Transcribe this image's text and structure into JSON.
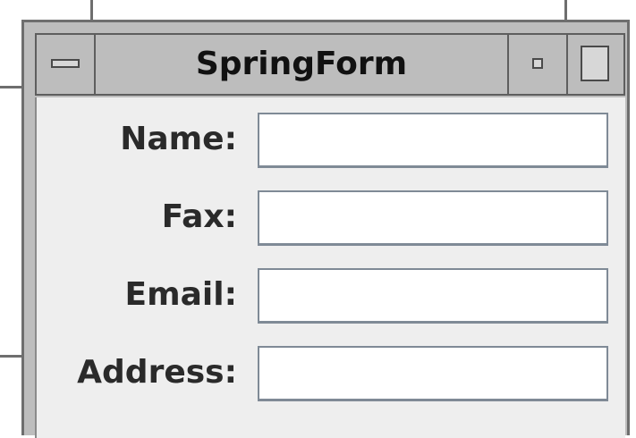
{
  "window": {
    "title": "SpringForm"
  },
  "titlebar": {
    "menu_icon": "window-menu-icon",
    "minimize_icon": "minimize-icon",
    "maximize_icon": "maximize-icon"
  },
  "form": {
    "fields": [
      {
        "label": "Name:",
        "value": ""
      },
      {
        "label": "Fax:",
        "value": ""
      },
      {
        "label": "Email:",
        "value": ""
      },
      {
        "label": "Address:",
        "value": ""
      }
    ]
  },
  "colors": {
    "frame": "#bdbdbd",
    "content_bg": "#eeeeee",
    "input_border": "#7f8a96",
    "text": "#2a2a2a"
  }
}
